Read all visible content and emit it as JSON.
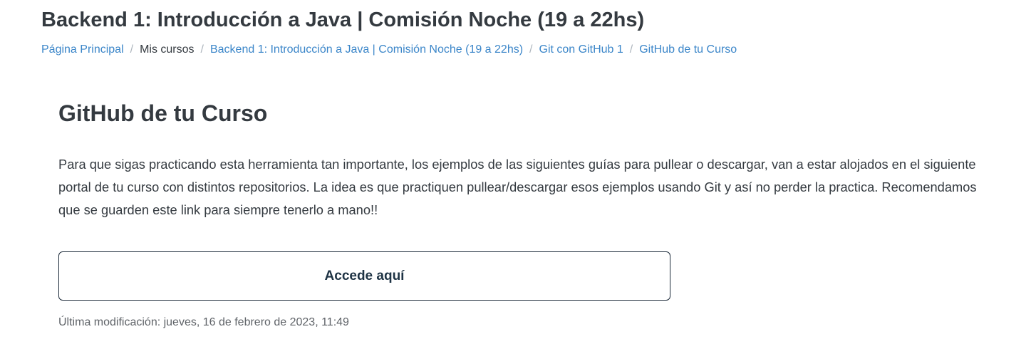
{
  "course": {
    "title": "Backend 1: Introducción a Java | Comisión Noche (19 a 22hs)"
  },
  "breadcrumb": {
    "separator": "/",
    "items": [
      {
        "label": "Página Principal",
        "link": true
      },
      {
        "label": "Mis cursos",
        "link": false
      },
      {
        "label": "Backend 1: Introducción a Java | Comisión Noche (19 a 22hs)",
        "link": true
      },
      {
        "label": "Git con GitHub 1",
        "link": true
      },
      {
        "label": "GitHub de tu Curso",
        "link": true
      }
    ]
  },
  "activity": {
    "title": "GitHub de tu Curso",
    "description": "Para que sigas practicando esta herramienta tan importante, los ejemplos de las siguientes guías para pullear o descargar, van a estar alojados en el siguiente portal de tu curso con distintos repositorios. La idea es que practiquen pullear/descargar esos ejemplos usando Git y así no perder la practica. Recomendamos que se guarden este link para siempre tenerlo a mano!!",
    "button_label": "Accede aquí",
    "last_modified": "Última modificación: jueves, 16 de febrero de 2023, 11:49"
  },
  "colors": {
    "link": "#3b86c9",
    "text": "#343a40",
    "button_border": "#1d2b3a"
  }
}
